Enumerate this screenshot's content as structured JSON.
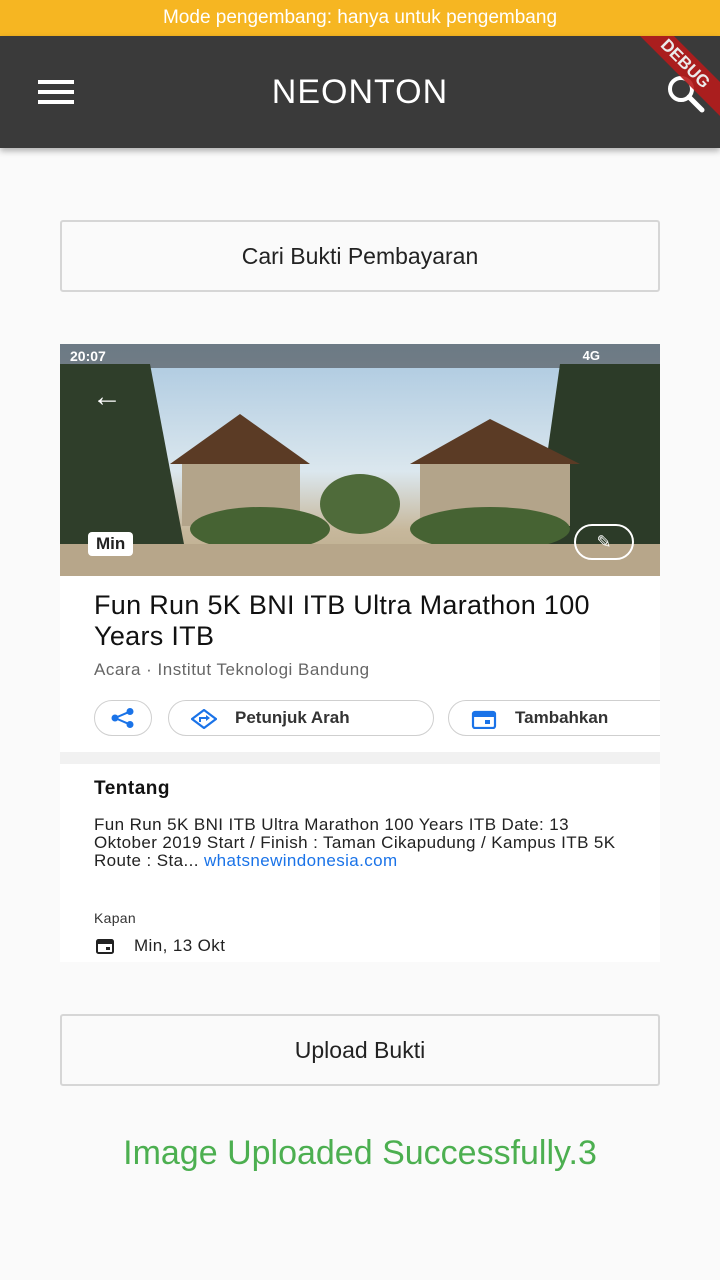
{
  "dev_banner": "Mode pengembang: hanya untuk pengembang",
  "app_bar": {
    "title": "NEONTON",
    "debug_label": "DEBUG"
  },
  "buttons": {
    "search_proof": "Cari Bukti Pembayaran",
    "upload_proof": "Upload Bukti"
  },
  "uploaded_image": {
    "status_time": "20:07",
    "status_network": "4G",
    "day_badge": "Min",
    "event_title": "Fun Run 5K BNI ITB Ultra Marathon 100 Years ITB",
    "event_subtitle": "Acara · Institut Teknologi Bandung",
    "chips": {
      "directions": "Petunjuk Arah",
      "add": "Tambahkan"
    },
    "about_heading": "Tentang",
    "about_text": "Fun Run 5K BNI ITB Ultra Marathon 100 Years ITB Date: 13 Oktober 2019 Start / Finish : Taman Cikapudung / Kampus ITB 5K Route : Sta... ",
    "about_link": "whatsnewindonesia.com",
    "when_label": "Kapan",
    "when_value": "Min, 13 Okt"
  },
  "status_message": "Image Uploaded Successfully.3",
  "colors": {
    "dev_banner": "#f6b622",
    "app_bar": "#3a3a3a",
    "success": "#4caf50",
    "link": "#1a73e8"
  }
}
